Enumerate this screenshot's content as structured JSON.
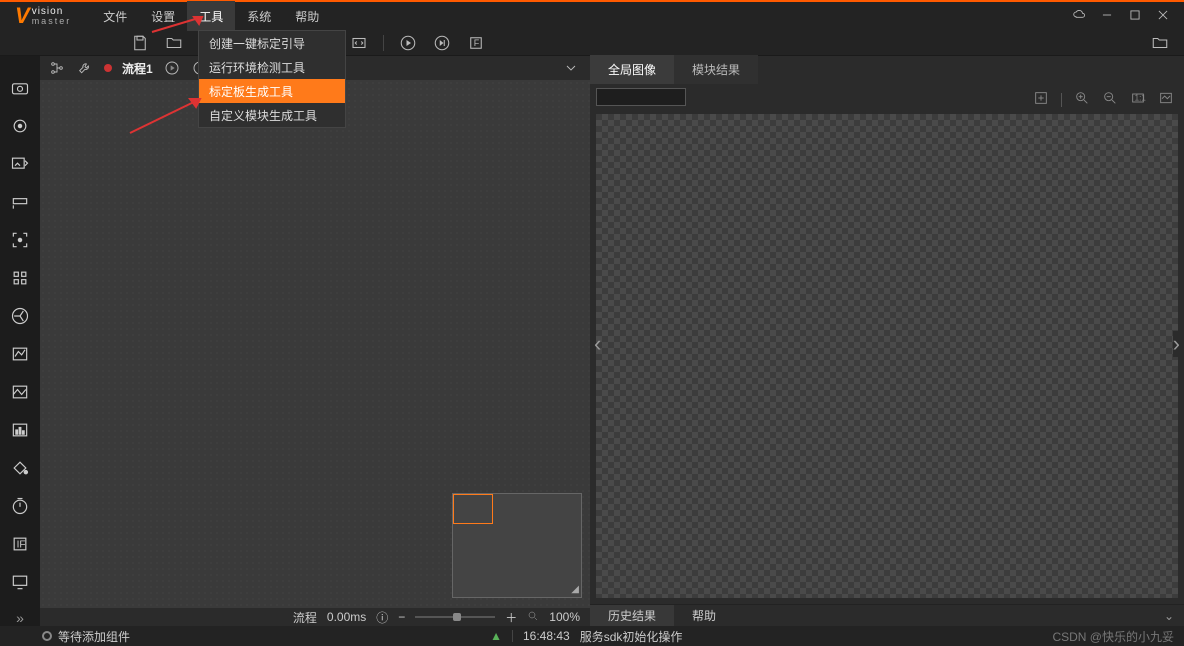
{
  "logo": {
    "top": "vision",
    "bottom": "master"
  },
  "menu": {
    "items": [
      "文件",
      "设置",
      "工具",
      "系统",
      "帮助"
    ],
    "active_index": 2
  },
  "tools_dropdown": {
    "items": [
      "创建一键标定引导",
      "运行环境检测工具",
      "标定板生成工具",
      "自定义模块生成工具"
    ],
    "highlight_index": 2
  },
  "flow": {
    "tab_name": "流程1",
    "status_label": "流程",
    "time_text": "0.00ms",
    "zoom_text": "100%"
  },
  "right_panel": {
    "tabs": [
      "全局图像",
      "模块结果"
    ],
    "bottom_tabs": [
      "历史结果",
      "帮助"
    ]
  },
  "statusbar": {
    "left_text": "等待添加组件",
    "msg_time": "16:48:43",
    "msg_text": "服务sdk初始化操作",
    "credit": "CSDN @快乐的小九妥"
  }
}
